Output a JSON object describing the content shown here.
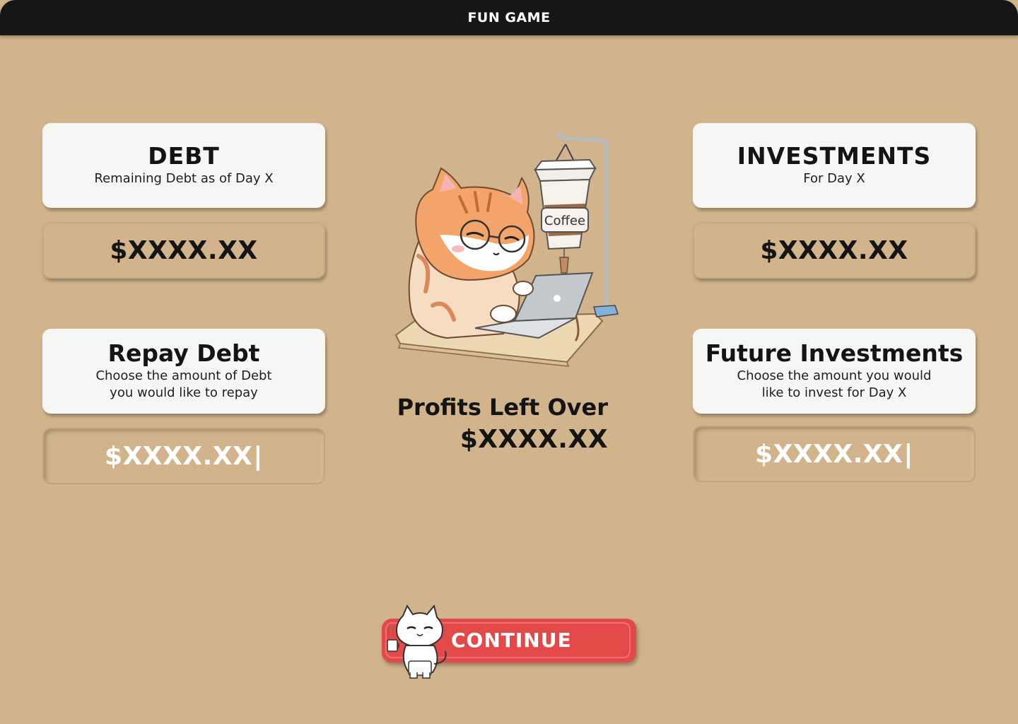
{
  "header": {
    "title": "FUN GAME"
  },
  "debt": {
    "title": "DEBT",
    "subtitle": "Remaining Debt as of Day X",
    "value": "$XXXX.XX"
  },
  "investments": {
    "title": "INVESTMENTS",
    "subtitle": "For Day X",
    "value": "$XXXX.XX"
  },
  "repay": {
    "title": "Repay Debt",
    "line1": "Choose the amount of Debt",
    "line2": "you would like to repay",
    "input_value": "$XXXX.XX"
  },
  "future": {
    "title": "Future Investments",
    "line1": "Choose the amount you would",
    "line2": "like to invest for Day X",
    "input_value": "$XXXX.XX"
  },
  "profits": {
    "label": "Profits Left Over",
    "value": "$XXXX.XX"
  },
  "illustration": {
    "cup_text": "Coffee"
  },
  "continue_button": {
    "label": "CONTINUE"
  },
  "colors": {
    "background": "#d1b48b",
    "titlebar": "#161616",
    "card": "#f6f7f5",
    "button": "#e44949"
  }
}
